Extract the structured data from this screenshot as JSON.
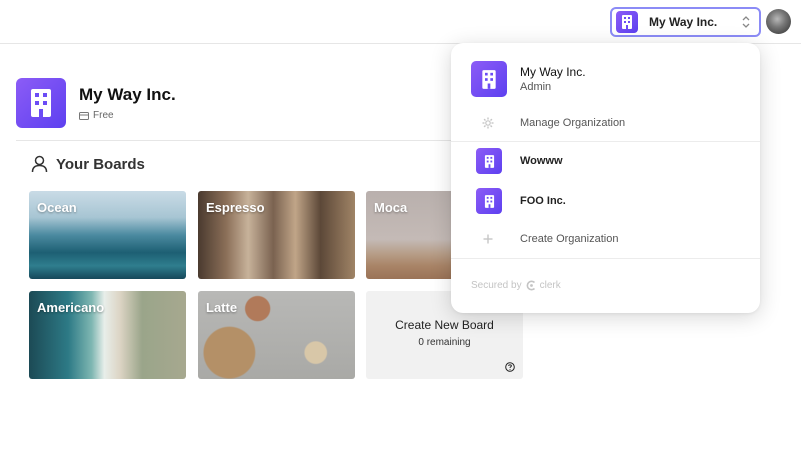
{
  "topbar": {
    "org_switcher_name": "My Way Inc."
  },
  "org": {
    "name": "My Way Inc.",
    "plan": "Free"
  },
  "boards_heading": "Your Boards",
  "boards": [
    {
      "label": "Ocean"
    },
    {
      "label": "Espresso"
    },
    {
      "label": "Moca"
    },
    {
      "label": "Americano"
    },
    {
      "label": "Latte"
    }
  ],
  "new_board": {
    "title": "Create New Board",
    "remaining": "0 remaining"
  },
  "dropdown": {
    "active_org": {
      "name": "My Way Inc.",
      "role": "Admin"
    },
    "manage_label": "Manage Organization",
    "orgs": [
      {
        "name": "Wowww"
      },
      {
        "name": "FOO Inc."
      }
    ],
    "create_label": "Create Organization",
    "secured_by": "Secured by",
    "secured_brand": "clerk"
  },
  "colors": {
    "accent": "#6b4cf5",
    "switcher_border": "#8b8bf6"
  },
  "icons": {
    "org_logo": "building-icon",
    "manage": "gear-icon",
    "create": "plus-icon",
    "boards": "user-icon",
    "help": "question-icon",
    "switcher": "chevron-up-down-icon"
  }
}
